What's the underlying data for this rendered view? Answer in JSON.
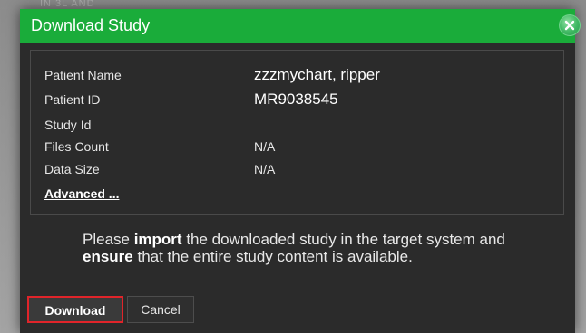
{
  "background": {
    "peek_text": "IN 3L AND"
  },
  "dialog": {
    "title": "Download Study",
    "close_icon": "close-circle-icon",
    "accent_color": "#1aac3a"
  },
  "study_info": {
    "patient_name": {
      "label": "Patient Name",
      "value": "zzzmychart, ripper"
    },
    "patient_id": {
      "label": "Patient ID",
      "value": "MR9038545"
    },
    "study_id": {
      "label": "Study Id",
      "value": ""
    },
    "files_count": {
      "label": "Files Count",
      "value": "N/A"
    },
    "data_size": {
      "label": "Data Size",
      "value": "N/A"
    },
    "advanced_link": "Advanced ..."
  },
  "notice": {
    "part1": "Please ",
    "bold1": "import",
    "part2": " the downloaded study in the target system and ",
    "bold2": "ensure",
    "part3": " that the entire study content is available."
  },
  "buttons": {
    "download_label": "Download",
    "download_highlight_color": "#e0242a",
    "cancel_label": "Cancel"
  }
}
